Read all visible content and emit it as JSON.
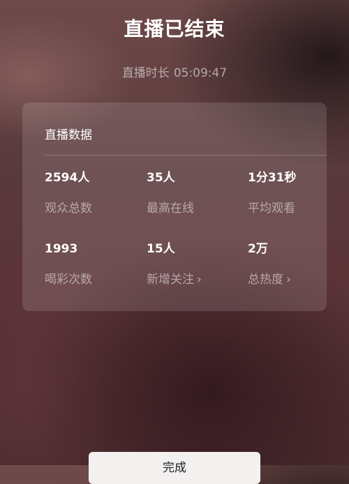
{
  "header": {
    "title": "直播已结束",
    "duration_label": "直播时长",
    "duration_value": "05:09:47"
  },
  "card": {
    "title": "直播数据",
    "stats": [
      {
        "value": "2594人",
        "label": "观众总数"
      },
      {
        "value": "35人",
        "label": "最高在线"
      },
      {
        "value": "1分31秒",
        "label": "平均观看"
      },
      {
        "value": "1993",
        "label": "喝彩次数"
      },
      {
        "value": "15人",
        "label": "新增关注"
      },
      {
        "value": "2万",
        "label": "总热度"
      }
    ]
  },
  "footer": {
    "done_label": "完成"
  },
  "icons": {
    "chevron": "chevron-right-icon"
  }
}
